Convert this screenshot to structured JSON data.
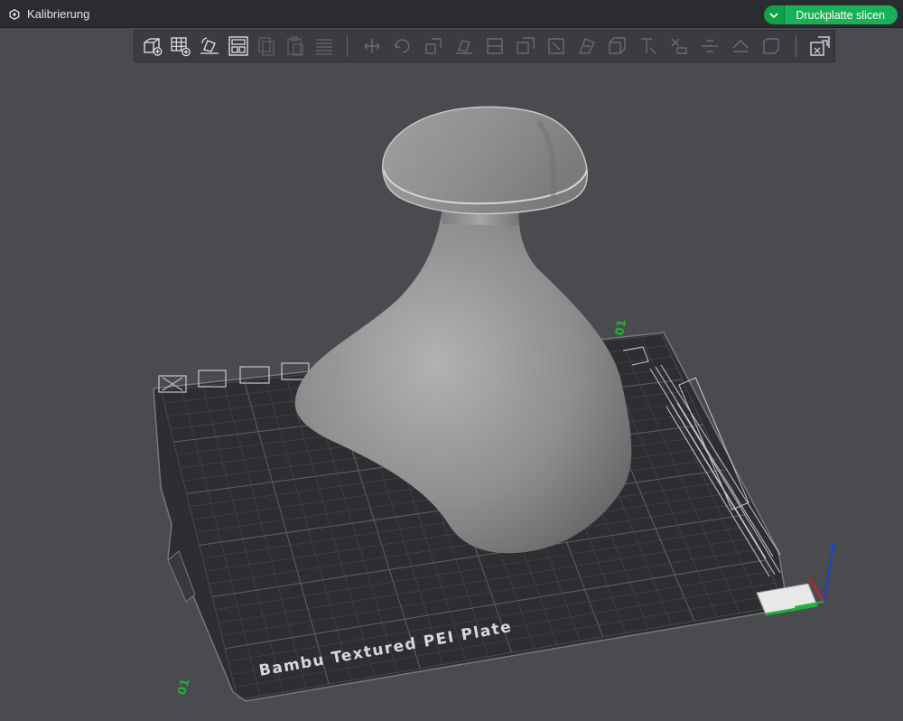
{
  "topbar": {
    "menu_label": "Kalibrierung",
    "menu_icon": "calibration-icon",
    "slice_button_label": "Druckplatte slicen",
    "slice_dropdown_icon": "chevron-down-icon"
  },
  "toolbar": {
    "active_tools": [
      "add-object-icon",
      "add-plate-icon",
      "auto-orient-icon",
      "arrange-icon"
    ],
    "disabled_tools": [
      "copy-icon",
      "paste-icon",
      "layers-icon"
    ],
    "object_tools": [
      "move-icon",
      "rotate-icon",
      "scale-icon",
      "lay-on-face-icon",
      "cut-icon",
      "boolean-icon",
      "support-paint-icon",
      "seam-paint-icon",
      "measure-icon",
      "text-icon",
      "assembly-icon",
      "split-icon",
      "variable-layer-height-icon",
      "mesh-boolean-icon"
    ],
    "end_tool": "assembly-view-icon"
  },
  "scene": {
    "plate_label": "Bambu Textured PEI Plate",
    "bed_label_front": "01",
    "bed_label_rear": "01",
    "model": "vase",
    "colors": {
      "background": "#4a4b4f",
      "plate": "#2f3033",
      "grid": "#55565a",
      "model": "#9a9a9b",
      "axis_x": "#d21e1e",
      "axis_y": "#20b03a",
      "axis_z": "#1f3fd8",
      "accent": "#19b057"
    }
  }
}
